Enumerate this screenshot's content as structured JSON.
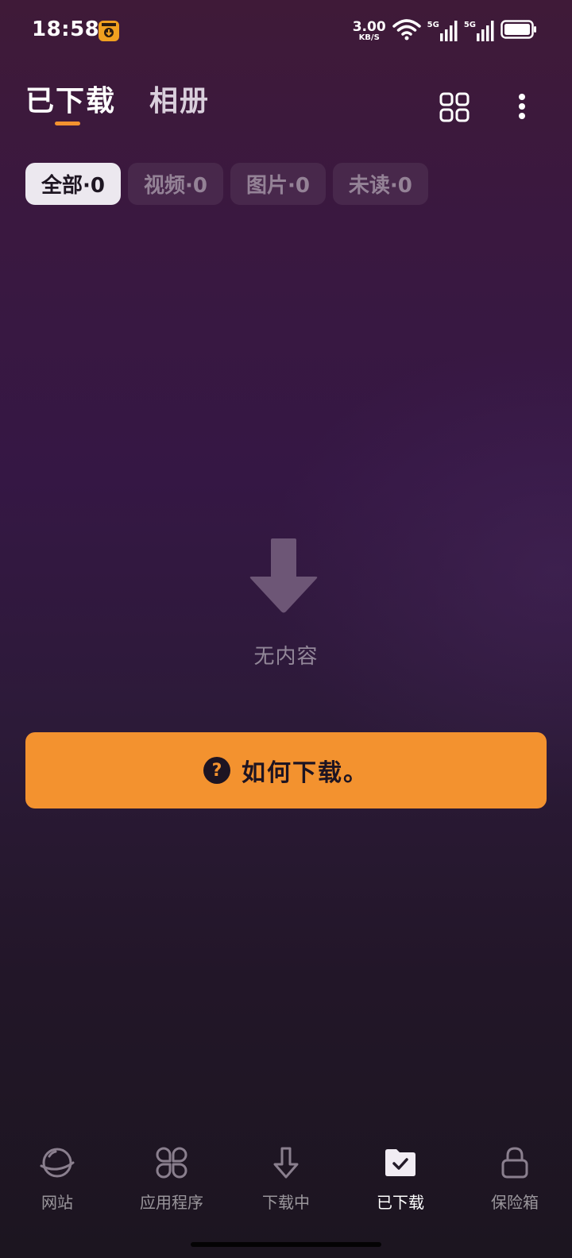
{
  "status_bar": {
    "time": "18:58",
    "net_speed_value": "3.00",
    "net_speed_unit": "KB/S",
    "sim1_tag": "5G",
    "sim2_tag": "5G",
    "battery_icon": "battery-icon"
  },
  "header": {
    "tab_downloaded": "已下载",
    "tab_album": "相册",
    "accent_color": "#f3922f"
  },
  "filters": [
    {
      "label": "全部·0",
      "active": true
    },
    {
      "label": "视频·0",
      "active": false
    },
    {
      "label": "图片·0",
      "active": false
    },
    {
      "label": "未读·0",
      "active": false
    }
  ],
  "empty_state": {
    "icon": "down-arrow-icon",
    "text": "无内容"
  },
  "how_to_button": {
    "icon": "question-icon",
    "label": "如何下载。"
  },
  "bottom_nav": [
    {
      "label": "网站",
      "icon": "planet-icon",
      "active": false
    },
    {
      "label": "应用程序",
      "icon": "apps-icon",
      "active": false
    },
    {
      "label": "下载中",
      "icon": "download-arrow-icon",
      "active": false
    },
    {
      "label": "已下载",
      "icon": "folder-check-icon",
      "active": true
    },
    {
      "label": "保险箱",
      "icon": "lock-icon",
      "active": false
    }
  ]
}
